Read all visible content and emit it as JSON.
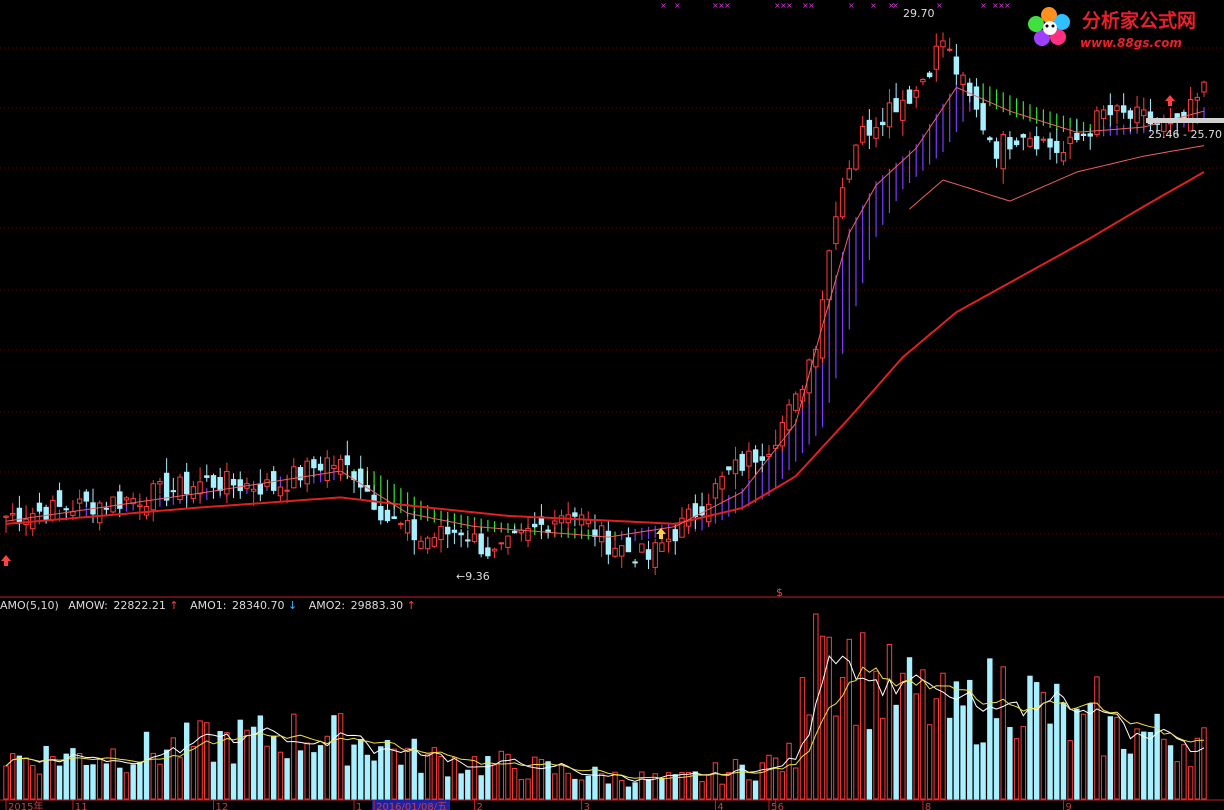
{
  "colors": {
    "up": "#ff3c3c",
    "down": "#a8f0ff",
    "ma_long": "#e02020",
    "ma_short": "#f06060",
    "fill_up": "#7a3cff",
    "fill_down": "#30e830",
    "grid": "#8a0000",
    "vol_line_white": "#ffffff",
    "vol_line_yellow": "#f0e040",
    "indicator_text": "#dcdcdc",
    "arrow_up": "#ff4040",
    "arrow_down": "#40b0ff"
  },
  "logo": {
    "name": "分析家公式网",
    "url": "www.88gs.com"
  },
  "price_annotations": {
    "high": "29.70",
    "low": "←9.36",
    "range": "25.46 - 25.70"
  },
  "indicator": {
    "name": "AMO(5,10)",
    "items": [
      {
        "label": "AMOW:",
        "value": "22822.21",
        "arrow": "↑"
      },
      {
        "label": "AMO1:",
        "value": "28340.70",
        "arrow": "↓"
      },
      {
        "label": "AMO2:",
        "value": "29883.30",
        "arrow": "↑"
      }
    ]
  },
  "time_axis": {
    "ticks": [
      "2015年",
      "11",
      "12",
      "1",
      "2016/01/08/五",
      "2",
      "3",
      "4",
      "5",
      "6",
      "8",
      "9"
    ]
  },
  "chart_data": [
    {
      "type": "candlestick",
      "title": "",
      "y_range": [
        8.5,
        30.5
      ],
      "x_count": 180,
      "close_path_keypoints": [
        [
          0,
          11.3
        ],
        [
          20,
          12.0
        ],
        [
          30,
          12.6
        ],
        [
          40,
          12.4
        ],
        [
          48,
          13.4
        ],
        [
          52,
          13.0
        ],
        [
          57,
          11.2
        ],
        [
          62,
          10.4
        ],
        [
          68,
          10.8
        ],
        [
          73,
          9.8
        ],
        [
          78,
          10.6
        ],
        [
          84,
          11.6
        ],
        [
          90,
          10.3
        ],
        [
          96,
          9.7
        ],
        [
          102,
          11.2
        ],
        [
          108,
          12.9
        ],
        [
          114,
          14.0
        ],
        [
          118,
          15.6
        ],
        [
          121,
          18.0
        ],
        [
          124,
          23.0
        ],
        [
          127,
          25.5
        ],
        [
          132,
          26.8
        ],
        [
          136,
          27.4
        ],
        [
          140,
          29.3
        ],
        [
          144,
          27.0
        ],
        [
          148,
          25.2
        ],
        [
          152,
          25.9
        ],
        [
          158,
          25.0
        ],
        [
          164,
          26.5
        ],
        [
          170,
          26.3
        ],
        [
          175,
          25.8
        ],
        [
          179,
          27.4
        ]
      ],
      "ma_short_keypoints": [
        [
          0,
          11.1
        ],
        [
          30,
          12.2
        ],
        [
          50,
          13.0
        ],
        [
          60,
          11.4
        ],
        [
          70,
          10.9
        ],
        [
          80,
          10.7
        ],
        [
          90,
          10.5
        ],
        [
          100,
          10.9
        ],
        [
          110,
          12.2
        ],
        [
          118,
          14.8
        ],
        [
          122,
          18.5
        ],
        [
          126,
          22.0
        ],
        [
          130,
          23.8
        ],
        [
          136,
          25.2
        ],
        [
          142,
          27.5
        ],
        [
          150,
          26.6
        ],
        [
          160,
          25.8
        ],
        [
          170,
          26.0
        ],
        [
          179,
          26.6
        ]
      ],
      "ma_long_keypoints": [
        [
          0,
          11.0
        ],
        [
          28,
          11.6
        ],
        [
          50,
          12.0
        ],
        [
          60,
          11.7
        ],
        [
          75,
          11.3
        ],
        [
          92,
          11.1
        ],
        [
          100,
          11.0
        ],
        [
          110,
          11.6
        ],
        [
          118,
          12.8
        ],
        [
          126,
          15.0
        ],
        [
          134,
          17.3
        ],
        [
          142,
          19.0
        ],
        [
          152,
          20.4
        ],
        [
          162,
          21.8
        ],
        [
          170,
          23.0
        ],
        [
          179,
          24.3
        ]
      ],
      "ma_mid_keypoints": [
        [
          135,
          22.9
        ],
        [
          140,
          24.0
        ],
        [
          150,
          23.2
        ],
        [
          160,
          24.3
        ],
        [
          170,
          24.9
        ],
        [
          179,
          25.3
        ]
      ],
      "series": [
        {
          "name": "AMOW",
          "value": 22822.21
        },
        {
          "name": "AMO1",
          "value": 28340.7
        },
        {
          "name": "AMO2",
          "value": 29883.3
        }
      ]
    },
    {
      "type": "bar",
      "title": "AMO(5,10)",
      "volume_keypoints": [
        [
          0,
          0.22
        ],
        [
          20,
          0.25
        ],
        [
          30,
          0.3
        ],
        [
          45,
          0.35
        ],
        [
          55,
          0.3
        ],
        [
          62,
          0.22
        ],
        [
          75,
          0.18
        ],
        [
          90,
          0.12
        ],
        [
          100,
          0.1
        ],
        [
          110,
          0.16
        ],
        [
          118,
          0.22
        ],
        [
          121,
          1.0
        ],
        [
          124,
          0.8
        ],
        [
          130,
          0.6
        ],
        [
          136,
          0.55
        ],
        [
          142,
          0.45
        ],
        [
          150,
          0.6
        ],
        [
          160,
          0.38
        ],
        [
          170,
          0.35
        ],
        [
          179,
          0.3
        ]
      ],
      "y_max": 30000
    }
  ]
}
